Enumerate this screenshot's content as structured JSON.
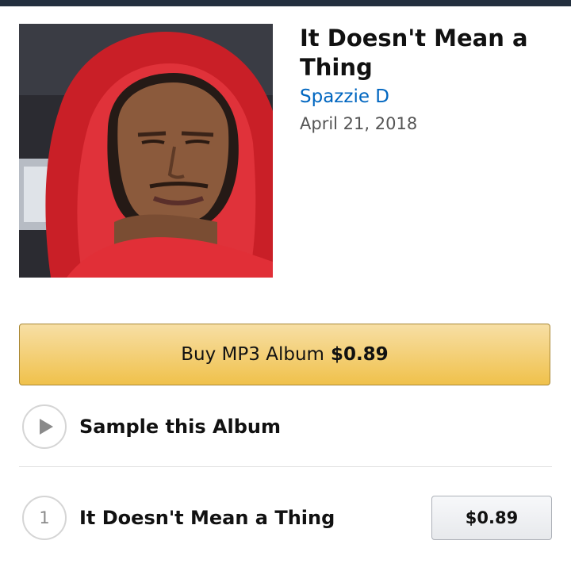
{
  "album": {
    "title": "It Doesn't Mean a Thing",
    "artist": "Spazzie D",
    "release_date": "April 21, 2018",
    "cover_icon": "album-cover-photo"
  },
  "purchase": {
    "buy_label": "Buy MP3 Album",
    "buy_price": "$0.89"
  },
  "sample": {
    "label": "Sample this Album",
    "icon": "play-icon"
  },
  "tracks": [
    {
      "number": "1",
      "title": "It Doesn't Mean a Thing",
      "price": "$0.89"
    }
  ],
  "colors": {
    "header_bar": "#232f3e",
    "buy_button": "#f0c14b",
    "link": "#0066c0",
    "hoodie": "#d8262c"
  }
}
